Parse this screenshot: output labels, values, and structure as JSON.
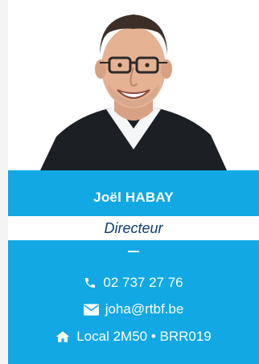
{
  "profile": {
    "name": "Joël HABAY",
    "role": "Directeur",
    "phone": "02 737 27 76",
    "email": "joha@rtbf.be",
    "location": "Local 2M50 • BRR019"
  },
  "icons": {
    "phone": "phone-icon",
    "email": "envelope-icon",
    "location": "home-icon"
  },
  "colors": {
    "accent": "#11a8e3",
    "role_text": "#0f3d70",
    "text_on_accent": "#ffffff"
  }
}
